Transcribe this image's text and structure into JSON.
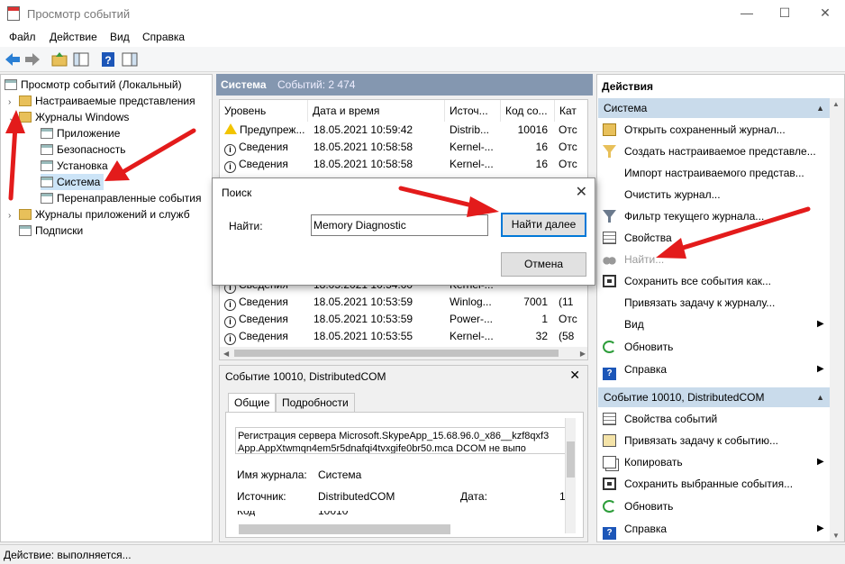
{
  "window": {
    "title": "Просмотр событий",
    "minimize": "—",
    "maximize": "☐",
    "close": "✕"
  },
  "menu": [
    "Файл",
    "Действие",
    "Вид",
    "Справка"
  ],
  "tree": {
    "root": "Просмотр событий (Локальный)",
    "custom_views": "Настраиваемые представления",
    "windows_logs": "Журналы Windows",
    "logs": [
      "Приложение",
      "Безопасность",
      "Установка",
      "Система",
      "Перенаправленные события"
    ],
    "app_logs": "Журналы приложений и служб",
    "subscriptions": "Подписки"
  },
  "center": {
    "log_name": "Система",
    "event_count": "Событий: 2 474",
    "columns": [
      "Уровень",
      "Дата и время",
      "Источ...",
      "Код со...",
      "Кат"
    ],
    "rows_top": [
      {
        "level": "Предупреж...",
        "icon": "warning-icon",
        "date": "18.05.2021 10:59:42",
        "source": "Distrib...",
        "code": "10016",
        "cat": "Отс"
      },
      {
        "level": "Сведения",
        "icon": "info-icon",
        "date": "18.05.2021 10:58:58",
        "source": "Kernel-...",
        "code": "16",
        "cat": "Отс"
      },
      {
        "level": "Сведения",
        "icon": "info-icon",
        "date": "18.05.2021 10:58:58",
        "source": "Kernel-...",
        "code": "16",
        "cat": "Отс"
      }
    ],
    "rows_bottom": [
      {
        "level": "Сведения",
        "icon": "info-icon",
        "date": "18.05.2021 10:54:00",
        "source": "Kernel-...",
        "code": "",
        "cat": ""
      },
      {
        "level": "Сведения",
        "icon": "info-icon",
        "date": "18.05.2021 10:53:59",
        "source": "Winlog...",
        "code": "7001",
        "cat": "(11"
      },
      {
        "level": "Сведения",
        "icon": "info-icon",
        "date": "18.05.2021 10:53:59",
        "source": "Power-...",
        "code": "1",
        "cat": "Отс"
      },
      {
        "level": "Сведения",
        "icon": "info-icon",
        "date": "18.05.2021 10:53:55",
        "source": "Kernel-...",
        "code": "32",
        "cat": "(58"
      }
    ]
  },
  "detail": {
    "title": "Событие 10010, DistributedCOM",
    "tabs": [
      "Общие",
      "Подробности"
    ],
    "text_line1": "Регистрация сервера Microsoft.SkypeApp_15.68.96.0_x86__kzf8qxf3",
    "text_line2": "App.AppXtwmqn4em5r5dnafqi4tvxgife0br50.mca DCOM не выпо",
    "log_label": "Имя журнала:",
    "log_value": "Система",
    "source_label": "Источник:",
    "source_value": "DistributedCOM",
    "date_label": "Дата:",
    "date_value": "1",
    "code_label": "Код",
    "code_value": "10010"
  },
  "actions": {
    "title": "Действия",
    "section1": "Система",
    "items1": [
      {
        "label": "Открыть сохраненный журнал...",
        "icon": "folder-open-icon"
      },
      {
        "label": "Создать настраиваемое представле...",
        "icon": "filter-create-icon"
      },
      {
        "label": "Импорт настраиваемого представ...",
        "icon": ""
      },
      {
        "label": "Очистить журнал...",
        "icon": ""
      },
      {
        "label": "Фильтр текущего журнала...",
        "icon": "filter-icon"
      },
      {
        "label": "Свойства",
        "icon": "properties-icon"
      },
      {
        "label": "Найти...",
        "icon": "binoculars-icon"
      },
      {
        "label": "Сохранить все события как...",
        "icon": "save-icon"
      },
      {
        "label": "Привязать задачу к журналу...",
        "icon": ""
      },
      {
        "label": "Вид",
        "icon": ""
      },
      {
        "label": "Обновить",
        "icon": "refresh-icon"
      },
      {
        "label": "Справка",
        "icon": "help-icon"
      }
    ],
    "section2": "Событие 10010, DistributedCOM",
    "items2": [
      {
        "label": "Свойства событий",
        "icon": "properties-icon"
      },
      {
        "label": "Привязать задачу к событию...",
        "icon": "task-icon"
      },
      {
        "label": "Копировать",
        "icon": "copy-icon"
      },
      {
        "label": "Сохранить выбранные события...",
        "icon": "save-icon"
      },
      {
        "label": "Обновить",
        "icon": "refresh-icon"
      },
      {
        "label": "Справка",
        "icon": "help-icon"
      }
    ]
  },
  "dialog": {
    "title": "Поиск",
    "find_label": "Найти:",
    "find_value": "Memory Diagnostic",
    "find_next": "Найти далее",
    "cancel": "Отмена"
  },
  "status": "Действие:  выполняется...",
  "colors": {
    "accent": "#0078d7",
    "pane_header": "#8497b0",
    "section": "#c9dbeb",
    "arrow": "#e31b1b"
  }
}
